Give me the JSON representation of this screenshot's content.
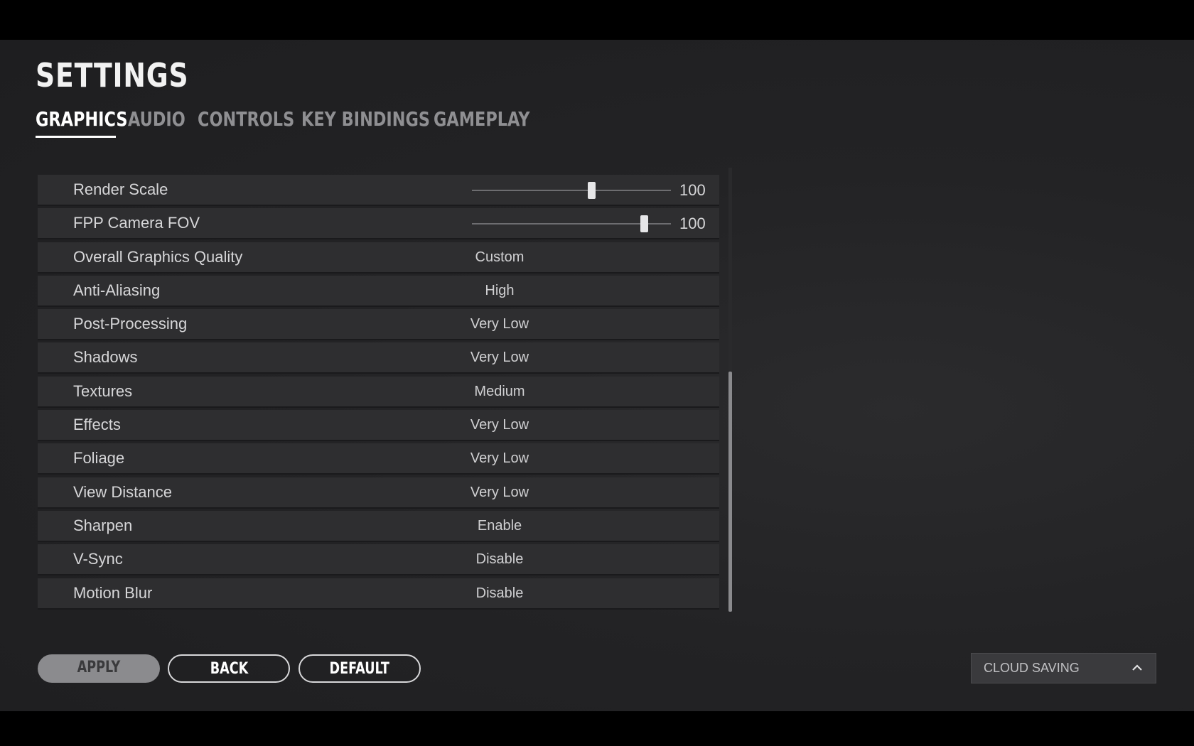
{
  "title": "SETTINGS",
  "tabs": [
    {
      "label": "GRAPHICS",
      "active": true
    },
    {
      "label": "AUDIO",
      "active": false
    },
    {
      "label": "CONTROLS",
      "active": false
    },
    {
      "label": "KEY BINDINGS",
      "active": false
    },
    {
      "label": "GAMEPLAY",
      "active": false
    }
  ],
  "settings": [
    {
      "label": "Render Scale",
      "type": "slider",
      "value": "100",
      "fraction": 0.6
    },
    {
      "label": "FPP Camera FOV",
      "type": "slider",
      "value": "100",
      "fraction": 0.865
    },
    {
      "label": "Overall Graphics Quality",
      "type": "select",
      "value": "Custom"
    },
    {
      "label": "Anti-Aliasing",
      "type": "select",
      "value": "High"
    },
    {
      "label": "Post-Processing",
      "type": "select",
      "value": "Very Low"
    },
    {
      "label": "Shadows",
      "type": "select",
      "value": "Very Low"
    },
    {
      "label": "Textures",
      "type": "select",
      "value": "Medium"
    },
    {
      "label": "Effects",
      "type": "select",
      "value": "Very Low"
    },
    {
      "label": "Foliage",
      "type": "select",
      "value": "Very Low"
    },
    {
      "label": "View Distance",
      "type": "select",
      "value": "Very Low"
    },
    {
      "label": "Sharpen",
      "type": "select",
      "value": "Enable"
    },
    {
      "label": "V-Sync",
      "type": "select",
      "value": "Disable"
    },
    {
      "label": "Motion Blur",
      "type": "select",
      "value": "Disable"
    }
  ],
  "buttons": {
    "apply": "APPLY",
    "back": "BACK",
    "default": "DEFAULT"
  },
  "cloud_saving": {
    "label": "CLOUD SAVING",
    "icon": "chevron-up-icon"
  }
}
